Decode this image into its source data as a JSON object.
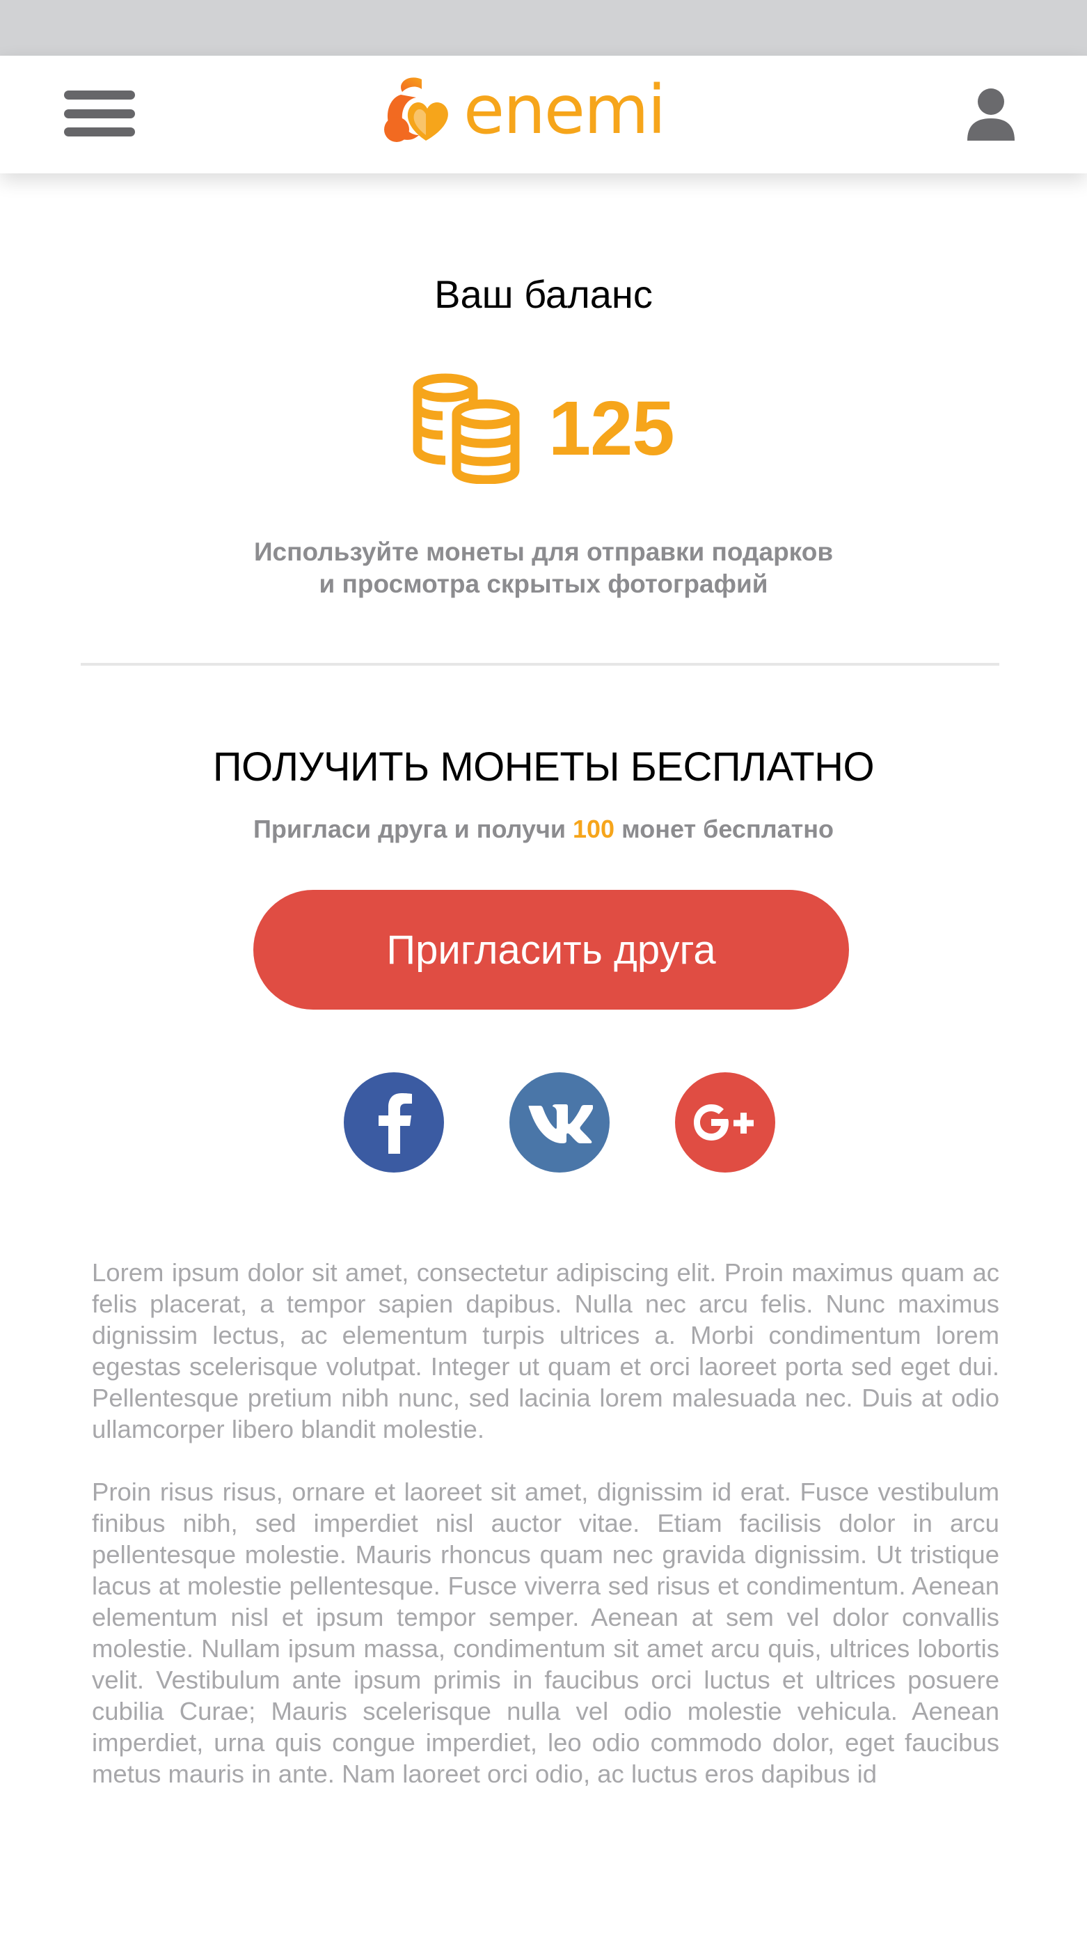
{
  "header": {
    "brand": "enemi",
    "menu_icon": "hamburger-menu-icon",
    "profile_icon": "user-icon"
  },
  "balance": {
    "title": "Ваш баланс",
    "value": "125",
    "description_line1": "Используйте монеты для отправки подарков",
    "description_line2": "и просмотра скрытых фотографий",
    "icon": "coins-icon"
  },
  "free_coins": {
    "title": "ПОЛУЧИТЬ МОНЕТЫ БЕСПЛАТНО",
    "subtitle_before": "Пригласи друга и получи ",
    "subtitle_amount": "100",
    "subtitle_after": " монет бесплатно",
    "invite_button": "Пригласить друга"
  },
  "social": [
    {
      "name": "facebook",
      "icon": "facebook-icon",
      "color": "#3b5ba2"
    },
    {
      "name": "vk",
      "icon": "vk-icon",
      "color": "#4a76a8"
    },
    {
      "name": "google-plus",
      "icon": "google-plus-icon",
      "color": "#e04d43"
    }
  ],
  "body_text": {
    "paragraph1": "Lorem ipsum dolor sit amet, consectetur adipiscing elit. Proin maximus quam ac felis placerat, a tempor sapien dapibus. Nulla nec arcu felis. Nunc maximus dignissim lectus, ac elementum turpis ultrices a. Morbi condimentum lorem egestas scelerisque volutpat. Integer ut quam et orci laoreet porta sed eget dui. Pellentesque pretium nibh nunc, sed lacinia lorem malesuada nec. Duis at odio ullamcorper libero blandit molestie.",
    "paragraph2": "Proin risus risus, ornare et laoreet sit amet, dignissim id erat. Fusce vestibulum finibus nibh, sed imperdiet nisl auctor vitae. Etiam facilisis dolor in arcu pellentesque molestie. Mauris rhoncus quam nec gravida dignissim. Ut tristique lacus at molestie pellentesque. Fusce viverra sed risus et condimentum. Aenean elementum nisl et ipsum tempor semper. Aenean at sem vel dolor convallis molestie. Nullam ipsum massa, condimentum sit amet arcu quis, ultrices lobortis velit. Vestibulum ante ipsum primis in faucibus orci luctus et ultrices posuere cubilia Curae; Mauris scelerisque nulla vel odio molestie vehicula. Aenean imperdiet, urna quis congue imperdiet, leo odio commodo dolor, eget faucibus metus mauris in ante. Nam laoreet orci odio, ac luctus eros dapibus id"
  },
  "colors": {
    "accent": "#f6a51b",
    "button": "#e04d43",
    "muted_text": "#8c8c8f",
    "status_bar": "#d1d2d4"
  }
}
